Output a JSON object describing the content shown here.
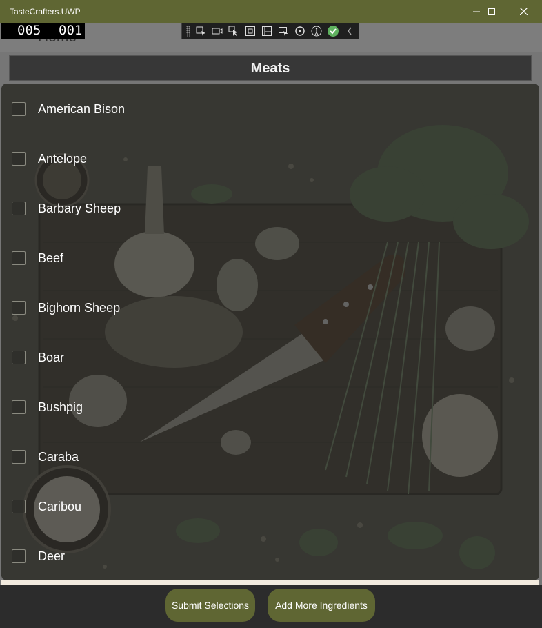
{
  "window": {
    "title": "TasteCrafters.UWP",
    "minimize_icon": "minimize-icon",
    "maximize_icon": "maximize-icon",
    "close_icon": "close-icon"
  },
  "nav": {
    "home_label": "Home",
    "menu_icon": "hamburger-icon"
  },
  "frame_counter": {
    "left": "005",
    "right": "001"
  },
  "debug_toolbar": {
    "tools": [
      "select-element-icon",
      "video-icon",
      "pointer-icon",
      "element-bounds-icon",
      "layout-adorner-icon",
      "track-focus-icon",
      "hot-reload-icon",
      "accessibility-icon",
      "check-icon",
      "collapse-chevron-icon"
    ]
  },
  "category": {
    "title": "Meats"
  },
  "items": [
    {
      "label": "American Bison",
      "checked": false
    },
    {
      "label": "Antelope",
      "checked": false
    },
    {
      "label": "Barbary Sheep",
      "checked": false
    },
    {
      "label": "Beef",
      "checked": false
    },
    {
      "label": "Bighorn Sheep",
      "checked": false
    },
    {
      "label": "Boar",
      "checked": false
    },
    {
      "label": "Bushpig",
      "checked": false
    },
    {
      "label": "Caraba",
      "checked": false
    },
    {
      "label": "Caribou",
      "checked": false
    },
    {
      "label": "Deer",
      "checked": false
    }
  ],
  "buttons": {
    "submit": "Submit Selections",
    "add_more": "Add More Ingredients"
  },
  "colors": {
    "accent": "#5f6633",
    "titlebar": "#5f6633",
    "panel": "#3a3a36"
  }
}
